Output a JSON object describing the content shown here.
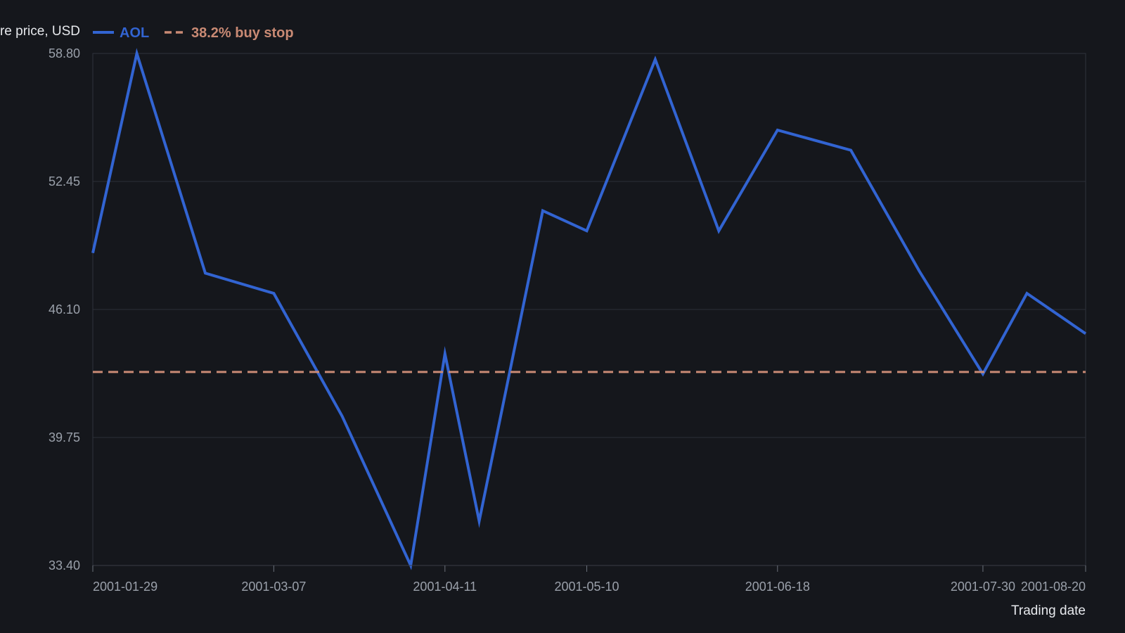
{
  "chart_data": {
    "type": "line",
    "ylabel": "Share price, USD",
    "xlabel": "Trading date",
    "ylim": [
      33.4,
      58.8
    ],
    "yticks": [
      "58.80",
      "52.45",
      "46.10",
      "39.75",
      "33.40"
    ],
    "xlim": [
      "2001-01-29",
      "2001-08-20"
    ],
    "xticks": [
      "2001-01-29",
      "2001-03-07",
      "2001-04-11",
      "2001-05-10",
      "2001-06-18",
      "2001-07-30",
      "2001-08-20"
    ],
    "grid": true,
    "legend_position": "top-left",
    "series": [
      {
        "name": "AOL",
        "color": "#3264d2",
        "style": "solid",
        "points": [
          {
            "x": "2001-01-29",
            "y": 48.9
          },
          {
            "x": "2001-02-07",
            "y": 58.8
          },
          {
            "x": "2001-02-21",
            "y": 47.9
          },
          {
            "x": "2001-03-07",
            "y": 46.9
          },
          {
            "x": "2001-03-21",
            "y": 40.8
          },
          {
            "x": "2001-04-04",
            "y": 33.4
          },
          {
            "x": "2001-04-11",
            "y": 43.9
          },
          {
            "x": "2001-04-18",
            "y": 35.6
          },
          {
            "x": "2001-05-01",
            "y": 51.0
          },
          {
            "x": "2001-05-10",
            "y": 50.0
          },
          {
            "x": "2001-05-24",
            "y": 58.5
          },
          {
            "x": "2001-06-06",
            "y": 50.0
          },
          {
            "x": "2001-06-18",
            "y": 55.0
          },
          {
            "x": "2001-07-03",
            "y": 54.0
          },
          {
            "x": "2001-07-17",
            "y": 48.0
          },
          {
            "x": "2001-07-30",
            "y": 42.9
          },
          {
            "x": "2001-08-08",
            "y": 46.9
          },
          {
            "x": "2001-08-20",
            "y": 44.9
          }
        ]
      },
      {
        "name": "38.2% buy stop",
        "color": "#c98a74",
        "style": "dashed",
        "points": [
          {
            "x": "2001-01-29",
            "y": 43.0
          },
          {
            "x": "2001-08-20",
            "y": 43.0
          }
        ]
      }
    ]
  }
}
